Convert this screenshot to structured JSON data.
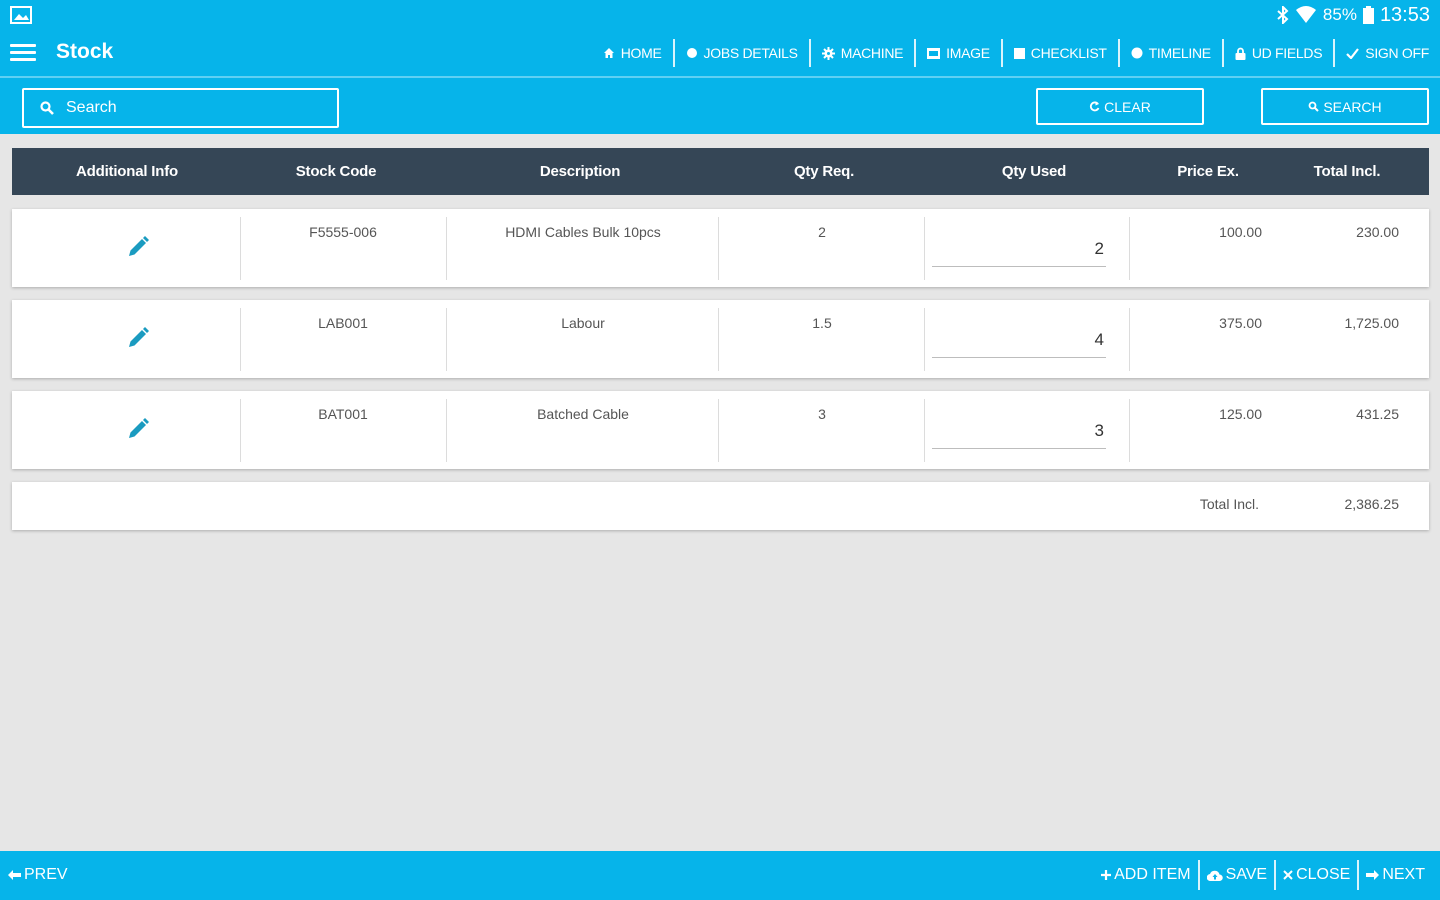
{
  "status": {
    "battery": "85%",
    "time": "13:53"
  },
  "app_bar": {
    "title": "Stock",
    "nav": [
      {
        "label": "HOME",
        "icon": "home-icon"
      },
      {
        "label": "JOBS DETAILS",
        "icon": "circle-icon"
      },
      {
        "label": "MACHINE",
        "icon": "gear-icon"
      },
      {
        "label": "IMAGE",
        "icon": "image-icon"
      },
      {
        "label": "CHECKLIST",
        "icon": "checklist-icon"
      },
      {
        "label": "TIMELINE",
        "icon": "clock-icon"
      },
      {
        "label": "UD FIELDS",
        "icon": "lock-icon"
      },
      {
        "label": "SIGN OFF",
        "icon": "check-icon"
      }
    ]
  },
  "search": {
    "placeholder": "Search",
    "clear_label": "CLEAR",
    "search_label": "SEARCH"
  },
  "table": {
    "headers": {
      "additional_info": "Additional Info",
      "stock_code": "Stock Code",
      "description": "Description",
      "qty_req": "Qty Req.",
      "qty_used": "Qty Used",
      "price_ex": "Price Ex.",
      "total_incl": "Total Incl."
    },
    "rows": [
      {
        "stock_code": "F5555-006",
        "description": "HDMI Cables Bulk 10pcs",
        "qty_req": "2",
        "qty_used": "2",
        "price_ex": "100.00",
        "total_incl": "230.00"
      },
      {
        "stock_code": "LAB001",
        "description": "Labour",
        "qty_req": "1.5",
        "qty_used": "4",
        "price_ex": "375.00",
        "total_incl": "1,725.00"
      },
      {
        "stock_code": "BAT001",
        "description": "Batched Cable",
        "qty_req": "3",
        "qty_used": "3",
        "price_ex": "125.00",
        "total_incl": "431.25"
      }
    ],
    "total_label": "Total Incl.",
    "total_value": "2,386.25"
  },
  "bottom_bar": {
    "prev_label": "PREV",
    "add_item_label": "ADD ITEM",
    "save_label": "SAVE",
    "close_label": "CLOSE",
    "next_label": "NEXT"
  },
  "colors": {
    "primary": "#06b4ea",
    "header_dark": "#354656",
    "edit_icon": "#1a9bc0",
    "background": "#e6e6e6"
  }
}
